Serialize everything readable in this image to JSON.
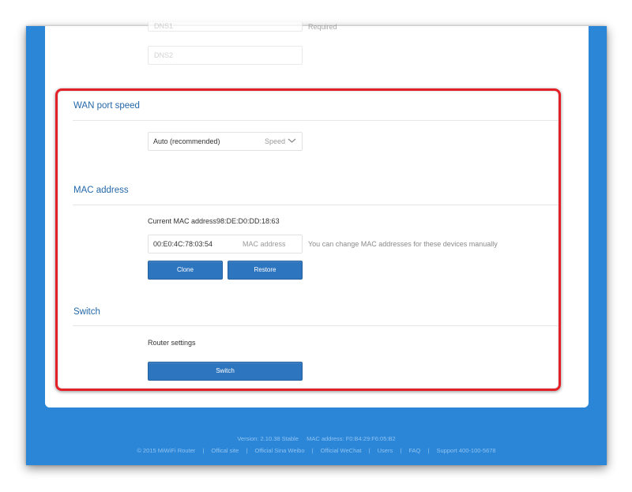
{
  "dns": {
    "dns1_placeholder": "DNS1",
    "dns1_hint": "Required",
    "dns2_placeholder": "DNS2"
  },
  "wan": {
    "title": "WAN port speed",
    "selected": "Auto (recommended)",
    "select_label": "Speed"
  },
  "mac": {
    "title": "MAC address",
    "current_label": "Current MAC address",
    "current_value": "98:DE:D0:DD:18:63",
    "input_value": "00:E0:4C:78:03:54",
    "input_label": "MAC address",
    "hint": "You can change MAC addresses for these devices manually",
    "clone_label": "Clone",
    "restore_label": "Restore"
  },
  "switch": {
    "title": "Switch",
    "label": "Router settings",
    "button_label": "Switch"
  },
  "footer": {
    "version_label": "Version: ",
    "version": "2.10.38 Stable",
    "mac_label": "MAC address: ",
    "mac": "F0:B4:29:F6:05:B2",
    "copyright": "© 2015 MiWiFi Router",
    "links": [
      "Offical site",
      "Official Sina Weibo",
      "Official WeChat",
      "Users",
      "FAQ",
      "Support 400-100-5678"
    ]
  },
  "colors": {
    "accent": "#2b86d8",
    "button": "#2d75bf",
    "title": "#2468a8",
    "highlight": "#e32028"
  }
}
